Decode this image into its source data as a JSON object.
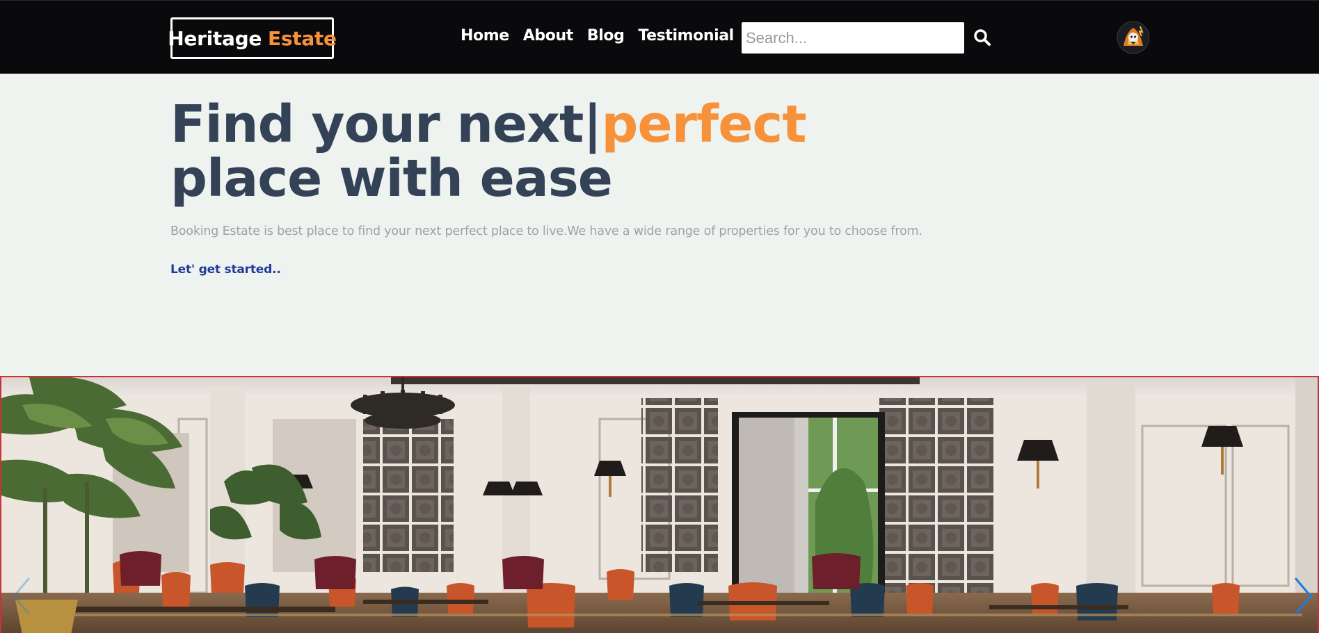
{
  "navbar": {
    "logo": {
      "text_main": "Heritage",
      "text_accent": "Estate"
    },
    "links": [
      {
        "label": "Home"
      },
      {
        "label": "About"
      },
      {
        "label": "Blog"
      },
      {
        "label": "Testimonial"
      }
    ],
    "search": {
      "placeholder": "Search...",
      "value": "",
      "icon": "search-icon"
    },
    "avatar_icon": "avatar-icon"
  },
  "hero": {
    "title_part1": "Find your next",
    "cursor": "|",
    "title_accent": "perfect",
    "title_part2": "place with ease",
    "subtitle": "Booking Estate is best place to find your next perfect place to live.We have a wide range of properties for you to choose from.",
    "cta": "Let' get started.."
  },
  "carousel": {
    "image": "restaurant-interior-photo",
    "prev_icon": "chevron-left-icon",
    "next_icon": "chevron-right-icon"
  },
  "colors": {
    "navbar_bg": "#0a0a0c",
    "accent": "#f7923a",
    "heading": "#344257",
    "page_bg": "#eff3f0",
    "cta": "#1e3a9a",
    "carousel_border": "#c8323a",
    "arrow": "#1e7be0"
  }
}
